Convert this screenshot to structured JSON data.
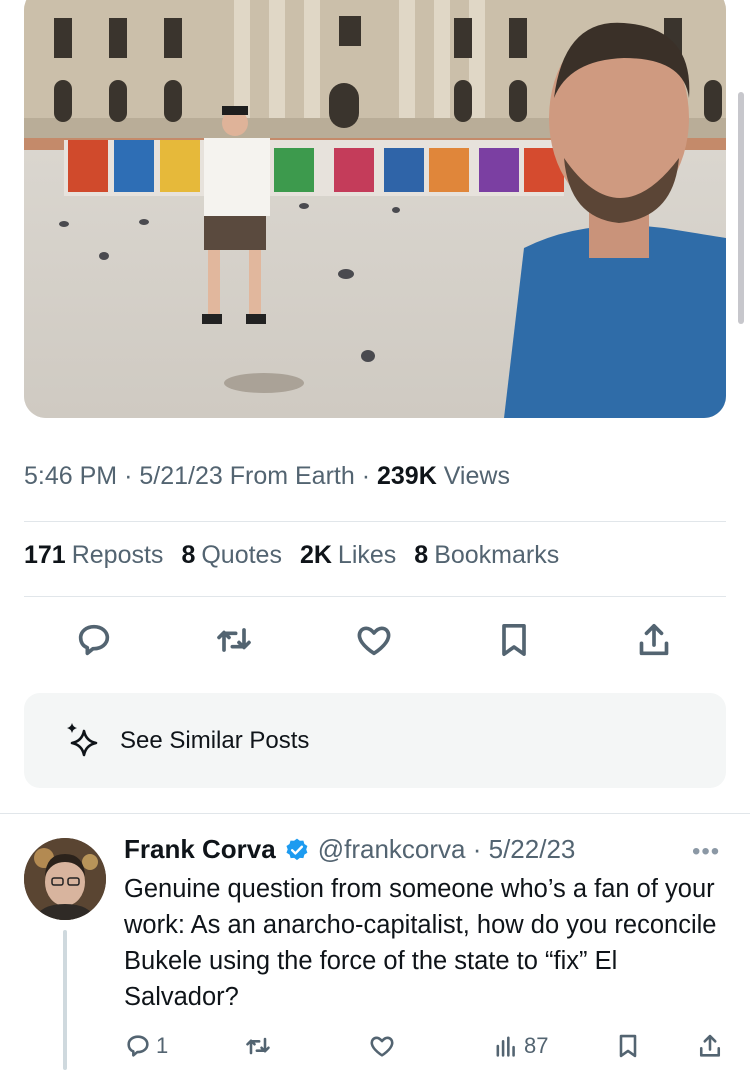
{
  "tweet": {
    "time": "5:46 PM",
    "date": "5/21/23",
    "source": "From Earth",
    "views_count": "239K",
    "views_label": "Views",
    "stats": [
      {
        "count": "171",
        "label": "Reposts"
      },
      {
        "count": "8",
        "label": "Quotes"
      },
      {
        "count": "2K",
        "label": "Likes"
      },
      {
        "count": "8",
        "label": "Bookmarks"
      }
    ],
    "actions": [
      "reply-icon",
      "repost-icon",
      "like-icon",
      "bookmark-icon",
      "share-icon"
    ]
  },
  "similar": {
    "label": "See Similar Posts",
    "icon": "sparkle-icon"
  },
  "reply": {
    "name": "Frank Corva",
    "verified": true,
    "handle": "@frankcorva",
    "date": "5/22/23",
    "more": "•••",
    "text": "Genuine question from someone who’s a fan of your work: As an anarcho-capitalist, how do you reconcile Bukele using the force of the state to “fix” El Salvador?",
    "reply_count": "1",
    "views": "87",
    "actions": [
      "reply-icon",
      "repost-icon",
      "like-icon",
      "views-icon",
      "bookmark-icon",
      "share-icon"
    ]
  },
  "colors": {
    "text": "#0f1419",
    "secondary": "#536471",
    "verified": "#1d9bf0",
    "divider": "#e1e6ea",
    "card": "#f4f6f6"
  }
}
